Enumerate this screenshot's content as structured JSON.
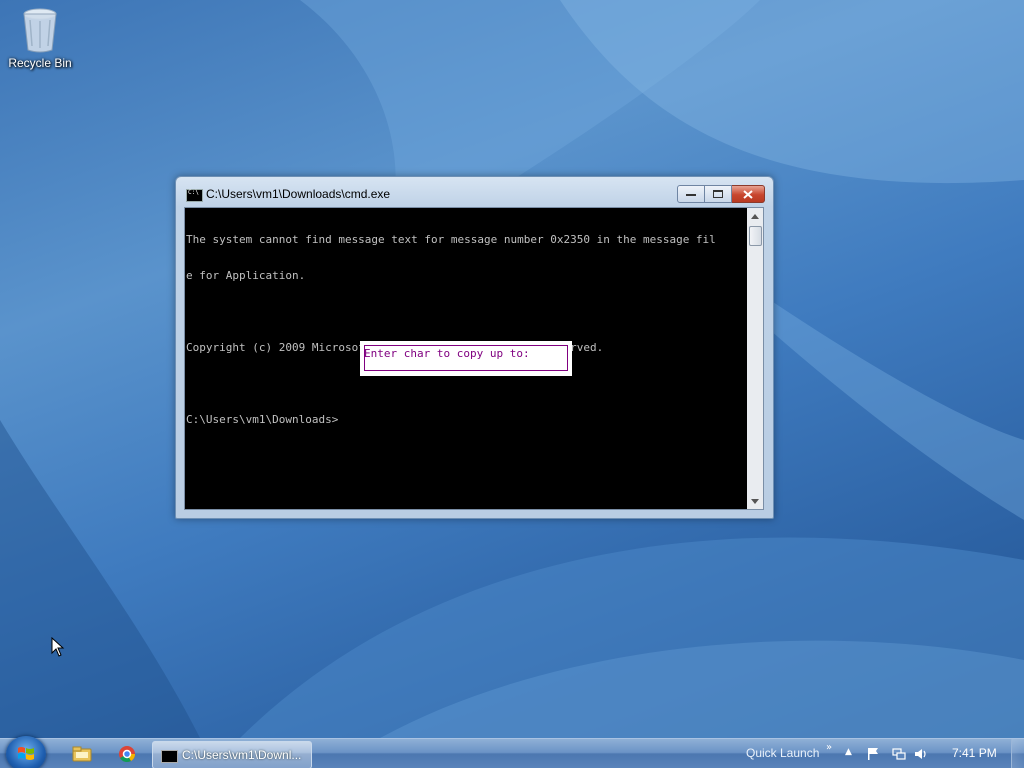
{
  "desktop": {
    "icons": [
      {
        "label": "Recycle Bin",
        "icon": "recycle-bin-icon"
      }
    ]
  },
  "window": {
    "title": "C:\\Users\\vm1\\Downloads\\cmd.exe",
    "icon": "console-icon",
    "buttons": {
      "minimize": "minimize",
      "maximize": "maximize",
      "close": "close"
    },
    "console_lines": [
      "The system cannot find message text for message number 0x2350 in the message fil",
      "e for Application.",
      "",
      "Copyright (c) 2009 Microsoft Corporation.  All rights reserved.",
      "",
      "C:\\Users\\vm1\\Downloads>"
    ],
    "prompt_text": "Enter char to copy up to:",
    "colors": {
      "console_bg": "#000000",
      "console_text": "#c0c0c0",
      "prompt": "#800080"
    }
  },
  "taskbar": {
    "start": "start-orb-icon",
    "pinned": [
      {
        "name": "windows-explorer-icon"
      },
      {
        "name": "chrome-icon"
      }
    ],
    "task_button_label": "C:\\Users\\vm1\\Downl...",
    "quick_launch": "Quick Launch",
    "quick_launch_chevron": "»",
    "tray_expand": "▲",
    "tray_icons": [
      "action-center-flag-icon",
      "network-icon",
      "volume-icon"
    ],
    "clock": "7:41 PM"
  }
}
